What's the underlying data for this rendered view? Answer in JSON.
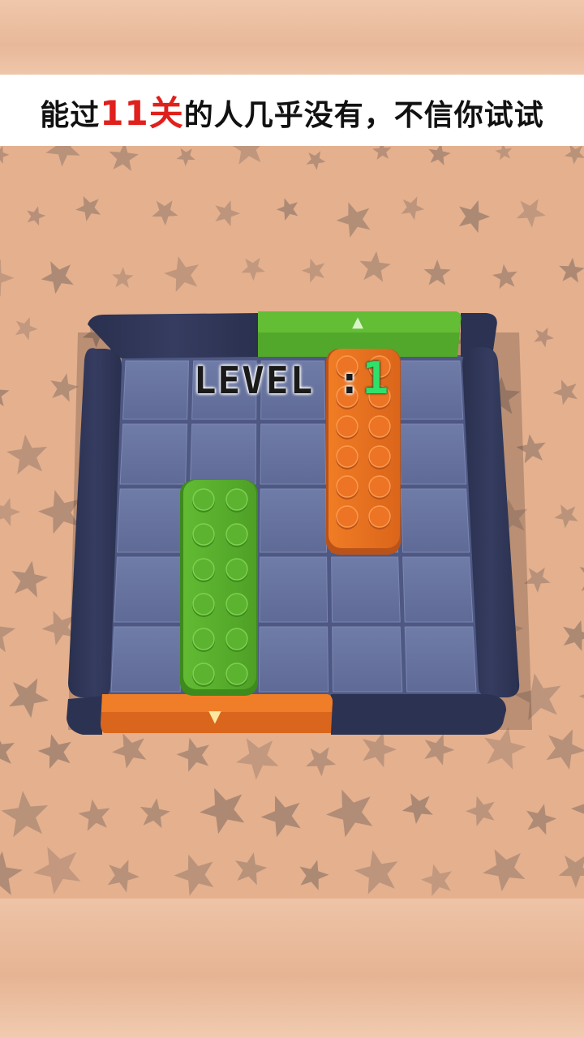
{
  "caption": {
    "prefix": "能过",
    "highlight": "11关",
    "suffix": "的人几乎没有，不信你试试"
  },
  "level": {
    "label": "LEVEL :",
    "number": "1"
  },
  "colors": {
    "background": "#e4b08e",
    "stars": "#9b7d6c",
    "frame": "#2f3656",
    "tile": "#6874a0",
    "green_block": "#57ad2c",
    "orange_block": "#e8701f",
    "level_number": "#2fe06a",
    "caption_highlight": "#e0201c"
  },
  "board": {
    "grid": {
      "cols": 5,
      "rows": 5
    },
    "blocks": [
      {
        "name": "green-block",
        "color": "green",
        "col": 1,
        "row": 2,
        "width": 1,
        "height": 3
      },
      {
        "name": "orange-block",
        "color": "orange",
        "col": 3,
        "row": 0,
        "width": 1,
        "height": 3
      }
    ],
    "exits": [
      {
        "name": "green-exit-gate",
        "color": "green",
        "side": "top",
        "arrow": "▲"
      },
      {
        "name": "orange-exit-gate",
        "color": "orange",
        "side": "bottom",
        "arrow": "▼"
      }
    ]
  }
}
